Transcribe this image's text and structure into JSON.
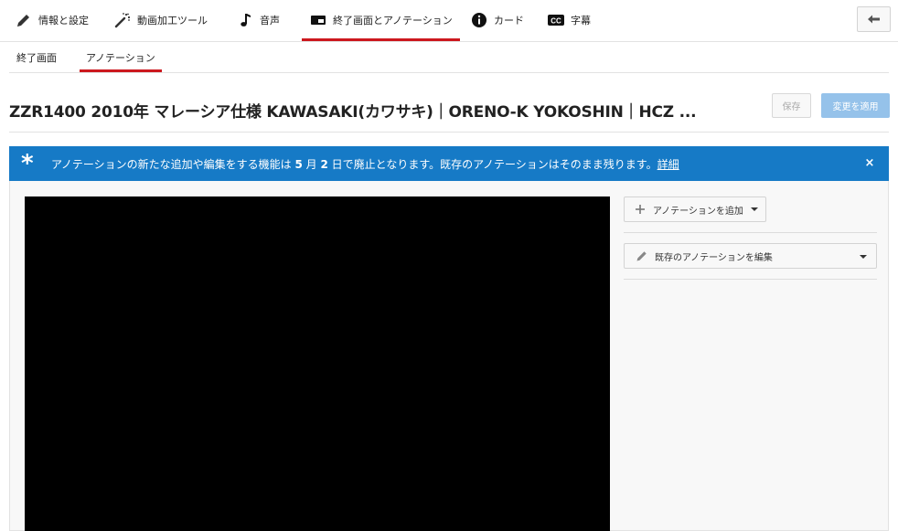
{
  "top_tabs": [
    {
      "label": "情報と設定",
      "icon": "pencil-icon"
    },
    {
      "label": "動画加工ツール",
      "icon": "magic-wand-icon"
    },
    {
      "label": "音声",
      "icon": "music-note-icon"
    },
    {
      "label": "終了画面とアノテーション",
      "icon": "end-screen-icon",
      "active": true
    },
    {
      "label": "カード",
      "icon": "info-icon"
    },
    {
      "label": "字幕",
      "icon": "cc-icon"
    }
  ],
  "sub_tabs": [
    {
      "label": "終了画面"
    },
    {
      "label": "アノテーション",
      "active": true
    }
  ],
  "video_title": "ZZR1400 2010年 マレーシア仕様 KAWASAKI(カワサキ)｜ORENO-K YOKOSHIN｜HCZ ...",
  "buttons": {
    "save": "保存",
    "apply": "変更を適用"
  },
  "banner": {
    "part1": "アノテーションの新たな追加や編集をする機能は ",
    "month": "5",
    "part2": " 月 ",
    "day": "2",
    "part3": " 日で廃止となります。既存のアノテーションはそのまま残ります。",
    "link": "詳細",
    "close": "×"
  },
  "side": {
    "add_annotation": "アノテーションを追加",
    "edit_existing": "既存のアノテーションを編集"
  },
  "colors": {
    "accent_red": "#cc181e",
    "banner_blue": "#167ac6",
    "apply_disabled": "#95c2ea"
  }
}
